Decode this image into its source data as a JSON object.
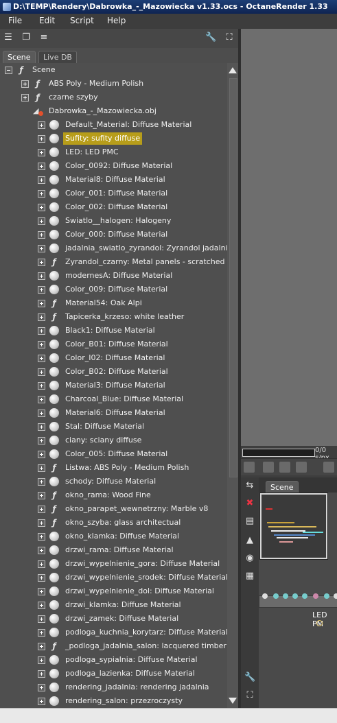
{
  "window": {
    "title": "D:\\TEMP\\Rendery\\Dabrowka_-_Mazowiecka v1.33.ocs - OctaneRender 1.33"
  },
  "menu": [
    "File",
    "Edit",
    "Script",
    "Help"
  ],
  "tabs": [
    "Scene",
    "Live DB"
  ],
  "tree": [
    {
      "label": "Scene",
      "depth": 0,
      "expander": "minus",
      "icon": "node"
    },
    {
      "label": "ABS Poly - Medium Polish",
      "depth": 1,
      "expander": "plus",
      "icon": "node"
    },
    {
      "label": "czarne szyby",
      "depth": 1,
      "expander": "plus",
      "icon": "node"
    },
    {
      "label": "Dabrowka_-_Mazowiecka.obj",
      "depth": 1,
      "expander": "none",
      "icon": "obj"
    },
    {
      "label": "Default_Material: Diffuse Material",
      "depth": 2,
      "expander": "plus",
      "icon": "sphere"
    },
    {
      "label": "Sufity: sufity diffuse",
      "depth": 2,
      "expander": "plus",
      "icon": "sphere",
      "selected": true
    },
    {
      "label": "LED: LED PMC",
      "depth": 2,
      "expander": "plus",
      "icon": "sphere"
    },
    {
      "label": "Color_0092: Diffuse Material",
      "depth": 2,
      "expander": "plus",
      "icon": "sphere"
    },
    {
      "label": "Material8: Diffuse Material",
      "depth": 2,
      "expander": "plus",
      "icon": "sphere"
    },
    {
      "label": "Color_001: Diffuse Material",
      "depth": 2,
      "expander": "plus",
      "icon": "sphere"
    },
    {
      "label": "Color_002: Diffuse Material",
      "depth": 2,
      "expander": "plus",
      "icon": "sphere"
    },
    {
      "label": "Swiatlo__halogen: Halogeny",
      "depth": 2,
      "expander": "plus",
      "icon": "sphere"
    },
    {
      "label": "Color_000: Diffuse Material",
      "depth": 2,
      "expander": "plus",
      "icon": "sphere"
    },
    {
      "label": "jadalnia_swiatlo_zyrandol: Zyrandol jadalnia",
      "depth": 2,
      "expander": "plus",
      "icon": "sphere"
    },
    {
      "label": "Zyrandol_czarny: Metal panels - scratched",
      "depth": 2,
      "expander": "plus",
      "icon": "node"
    },
    {
      "label": "modernesA: Diffuse Material",
      "depth": 2,
      "expander": "plus",
      "icon": "sphere"
    },
    {
      "label": "Color_009: Diffuse Material",
      "depth": 2,
      "expander": "plus",
      "icon": "sphere"
    },
    {
      "label": "Material54: Oak Alpi",
      "depth": 2,
      "expander": "plus",
      "icon": "node"
    },
    {
      "label": "Tapicerka_krzeso: white leather",
      "depth": 2,
      "expander": "plus",
      "icon": "node"
    },
    {
      "label": "Black1: Diffuse Material",
      "depth": 2,
      "expander": "plus",
      "icon": "sphere"
    },
    {
      "label": "Color_B01: Diffuse Material",
      "depth": 2,
      "expander": "plus",
      "icon": "sphere"
    },
    {
      "label": "Color_I02: Diffuse Material",
      "depth": 2,
      "expander": "plus",
      "icon": "sphere"
    },
    {
      "label": "Color_B02: Diffuse Material",
      "depth": 2,
      "expander": "plus",
      "icon": "sphere"
    },
    {
      "label": "Material3: Diffuse Material",
      "depth": 2,
      "expander": "plus",
      "icon": "sphere"
    },
    {
      "label": "Charcoal_Blue: Diffuse Material",
      "depth": 2,
      "expander": "plus",
      "icon": "sphere"
    },
    {
      "label": "Material6: Diffuse Material",
      "depth": 2,
      "expander": "plus",
      "icon": "sphere"
    },
    {
      "label": "Stal: Diffuse Material",
      "depth": 2,
      "expander": "plus",
      "icon": "sphere"
    },
    {
      "label": "ciany: sciany diffuse",
      "depth": 2,
      "expander": "plus",
      "icon": "sphere"
    },
    {
      "label": "Color_005: Diffuse Material",
      "depth": 2,
      "expander": "plus",
      "icon": "sphere"
    },
    {
      "label": "Listwa: ABS Poly - Medium Polish",
      "depth": 2,
      "expander": "plus",
      "icon": "node"
    },
    {
      "label": "schody: Diffuse Material",
      "depth": 2,
      "expander": "plus",
      "icon": "sphere"
    },
    {
      "label": "okno_rama: Wood Fine",
      "depth": 2,
      "expander": "plus",
      "icon": "node"
    },
    {
      "label": "okno_parapet_wewnetrzny: Marble v8",
      "depth": 2,
      "expander": "plus",
      "icon": "node"
    },
    {
      "label": "okno_szyba: glass architectual",
      "depth": 2,
      "expander": "plus",
      "icon": "node"
    },
    {
      "label": "okno_klamka: Diffuse Material",
      "depth": 2,
      "expander": "plus",
      "icon": "sphere"
    },
    {
      "label": "drzwi_rama: Diffuse Material",
      "depth": 2,
      "expander": "plus",
      "icon": "sphere"
    },
    {
      "label": "drzwi_wypelnienie_gora: Diffuse Material",
      "depth": 2,
      "expander": "plus",
      "icon": "sphere"
    },
    {
      "label": "drzwi_wypelnienie_srodek: Diffuse Material",
      "depth": 2,
      "expander": "plus",
      "icon": "sphere"
    },
    {
      "label": "drzwi_wypelnienie_dol: Diffuse Material",
      "depth": 2,
      "expander": "plus",
      "icon": "sphere"
    },
    {
      "label": "drzwi_klamka: Diffuse Material",
      "depth": 2,
      "expander": "plus",
      "icon": "sphere"
    },
    {
      "label": "drzwi_zamek: Diffuse Material",
      "depth": 2,
      "expander": "plus",
      "icon": "sphere"
    },
    {
      "label": "podloga_kuchnia_korytarz: Diffuse Material",
      "depth": 2,
      "expander": "plus",
      "icon": "sphere"
    },
    {
      "label": "_podloga_jadalnia_salon: lacquered timber",
      "depth": 2,
      "expander": "plus",
      "icon": "node"
    },
    {
      "label": "podloga_sypialnia: Diffuse Material",
      "depth": 2,
      "expander": "plus",
      "icon": "sphere"
    },
    {
      "label": "podloga_lazienka: Diffuse Material",
      "depth": 2,
      "expander": "plus",
      "icon": "sphere"
    },
    {
      "label": "rendering_jadalnia: rendering jadalnia",
      "depth": 2,
      "expander": "plus",
      "icon": "sphere"
    },
    {
      "label": "rendering_salon: przezroczysty",
      "depth": 2,
      "expander": "plus",
      "icon": "sphere"
    }
  ],
  "render": {
    "progress_text": "0/0 s/px"
  },
  "graph": {
    "tab": "Scene",
    "node_label": "LED PM"
  },
  "colors": {
    "selection": "#b79d1a",
    "titlebar": "#1d3e75"
  }
}
